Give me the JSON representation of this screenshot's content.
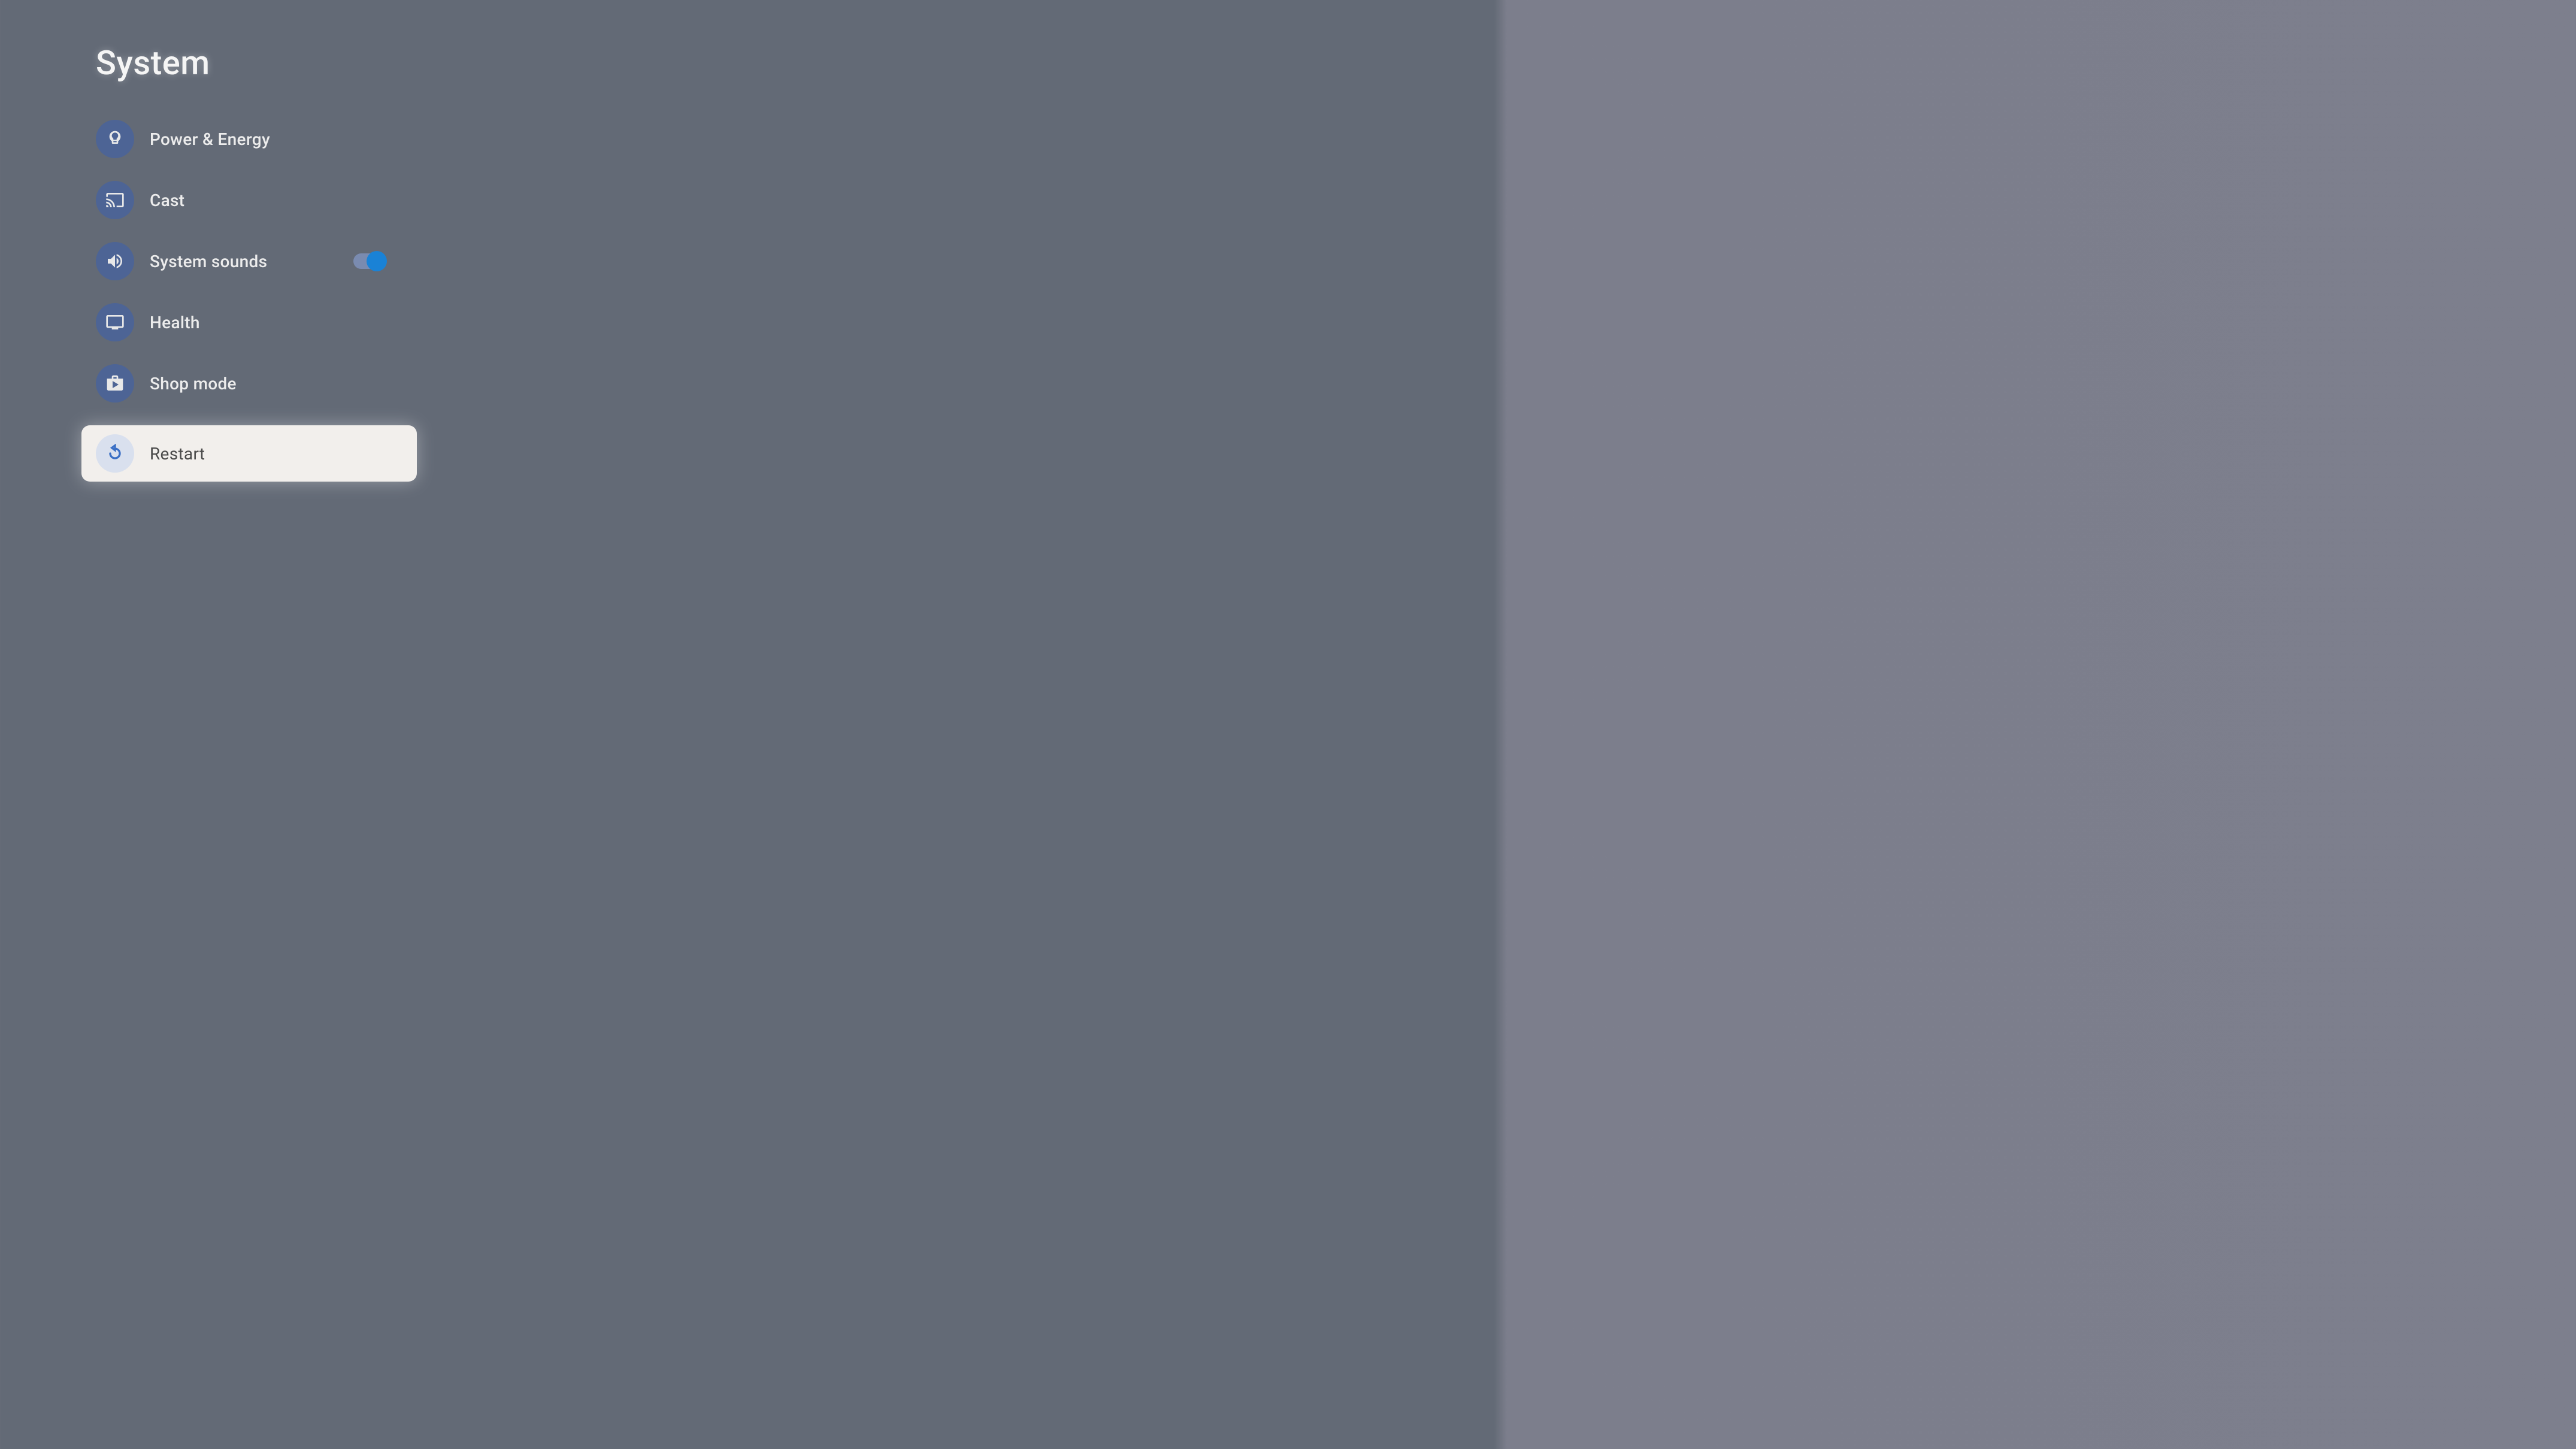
{
  "header": {
    "title": "System"
  },
  "menu": {
    "items": [
      {
        "label": "Power & Energy",
        "icon": "lightbulb-icon",
        "selected": false,
        "hasToggle": false
      },
      {
        "label": "Cast",
        "icon": "cast-icon",
        "selected": false,
        "hasToggle": false
      },
      {
        "label": "System sounds",
        "icon": "volume-icon",
        "selected": false,
        "hasToggle": true,
        "toggleOn": true
      },
      {
        "label": "Health",
        "icon": "tv-icon",
        "selected": false,
        "hasToggle": false
      },
      {
        "label": "Shop mode",
        "icon": "shop-icon",
        "selected": false,
        "hasToggle": false
      },
      {
        "label": "Restart",
        "icon": "restart-icon",
        "selected": true,
        "hasToggle": false
      }
    ]
  }
}
